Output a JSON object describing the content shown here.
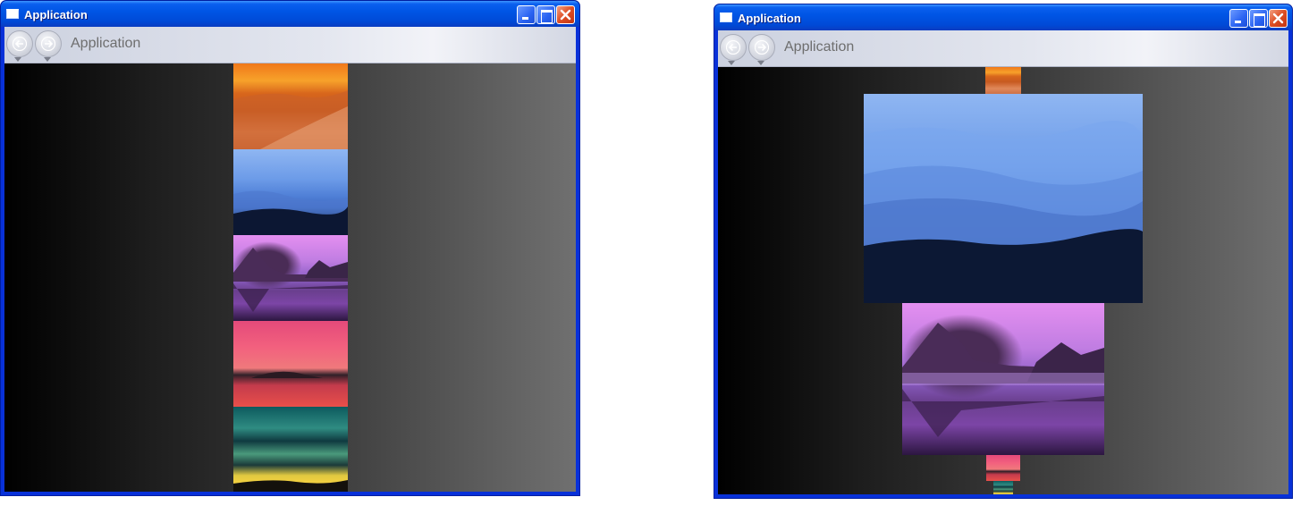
{
  "windows": [
    {
      "title": "Application",
      "nav_title": "Application",
      "photos": [
        "desert",
        "ridges",
        "lake",
        "sunset",
        "aurora"
      ]
    },
    {
      "title": "Application",
      "nav_title": "Application",
      "photos": [
        "desert",
        "ridges",
        "lake",
        "sunset",
        "aurora"
      ]
    }
  ],
  "icons": {
    "window": "window-icon",
    "back": "back-arrow-icon",
    "forward": "forward-arrow-icon",
    "minimize": "minimize-icon",
    "maximize": "maximize-icon",
    "close": "close-icon"
  },
  "colors": {
    "titlebar": "#0055e5",
    "close": "#de4d23",
    "nav_text": "#6e6e6e"
  }
}
